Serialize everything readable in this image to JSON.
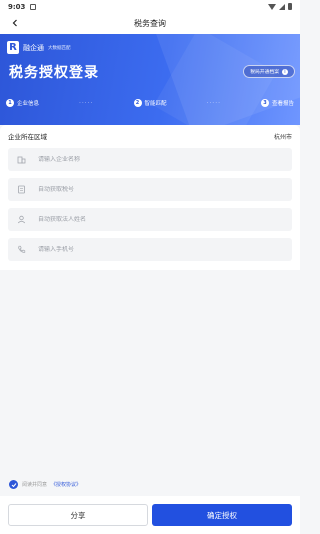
{
  "status_bar": {
    "time": "9:03",
    "notification_icon": "sim-card-icon",
    "icons": [
      "wifi-icon",
      "signal-icon",
      "battery-icon"
    ]
  },
  "nav": {
    "title": "税务查询",
    "back_icon": "chevron-left-icon"
  },
  "hero": {
    "brand_logo_letter": "R",
    "brand_name": "融企通",
    "brand_tag": "大数据匹配",
    "headline": "税务授权登录",
    "progress_button": "税局开通档案",
    "progress_icon": "info-icon"
  },
  "steps": [
    {
      "num": "1",
      "label": "企业信息"
    },
    {
      "num": "2",
      "label": "智能匹配"
    },
    {
      "num": "3",
      "label": "查看报告"
    }
  ],
  "step_separator": "·····",
  "form": {
    "region_label": "企业所在区域",
    "region_value": "杭州市",
    "fields": [
      {
        "placeholder": "请输入企业名称",
        "icon": "building-icon"
      },
      {
        "placeholder": "自动获取税号",
        "icon": "document-icon"
      },
      {
        "placeholder": "自动获取法人姓名",
        "icon": "person-icon"
      },
      {
        "placeholder": "请输入手机号",
        "icon": "phone-icon"
      }
    ]
  },
  "agreement": {
    "read_text": "阅读并同意",
    "link_text": "《授权协议》",
    "checked": true
  },
  "buttons": {
    "share": "分享",
    "confirm": "确定授权"
  },
  "colors": {
    "primary": "#2250e0",
    "hero_start": "#2d56d8",
    "hero_end": "#6f96ff",
    "field_bg": "#f3f4f6",
    "page_bg": "#f5f6f8"
  }
}
